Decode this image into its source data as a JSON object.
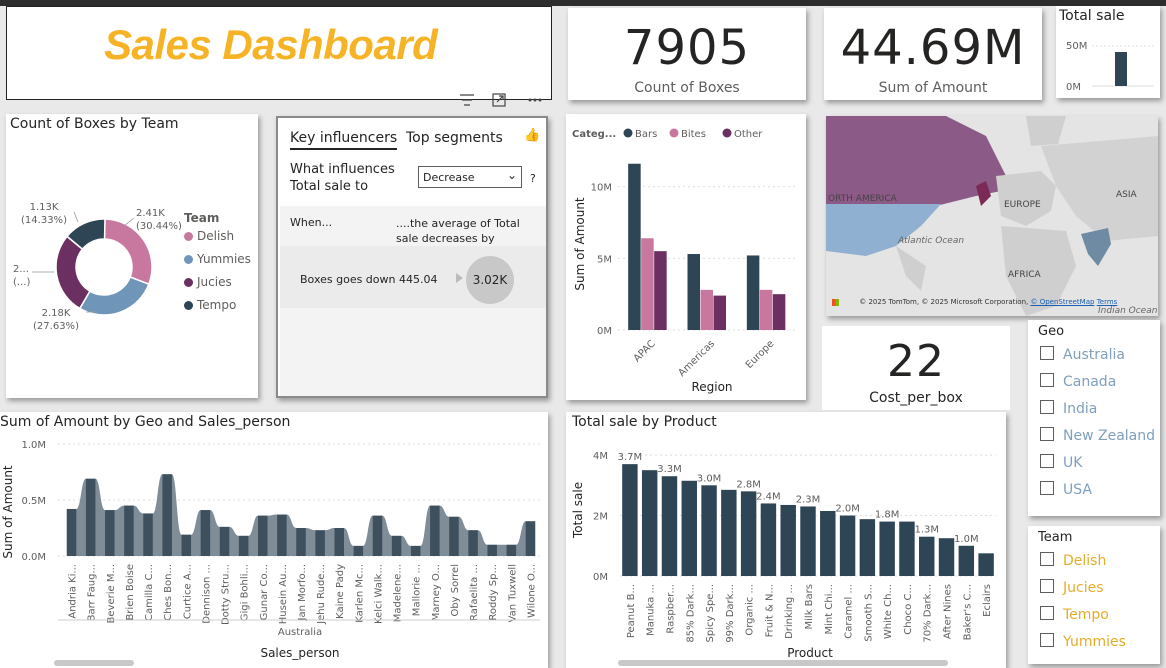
{
  "header": {
    "title": "Sales Dashboard"
  },
  "kpis": {
    "boxes": {
      "value": "7905",
      "label": "Count of Boxes"
    },
    "amount": {
      "value": "44.69M",
      "label": "Sum of Amount"
    },
    "cost": {
      "value": "22",
      "label": "Cost_per_box"
    }
  },
  "visual_header_icons": [
    "filter-icon",
    "focus-mode-icon",
    "more-options-icon"
  ],
  "total_sale_mini": {
    "title": "Total sale",
    "ticks": [
      "50M",
      "0M"
    ],
    "value_fraction": 0.85
  },
  "donut": {
    "title": "Count of Boxes by Team",
    "legend_title": "Team",
    "labels": [
      {
        "text_line1": "2.41K",
        "text_line2": "(30.44%)"
      },
      {
        "text_line1": "2.18K",
        "text_line2": "(27.63%)"
      },
      {
        "text_line1": "2...",
        "text_line2": "(...)"
      },
      {
        "text_line1": "1.13K",
        "text_line2": "(14.33%)"
      }
    ],
    "teams": [
      {
        "name": "Delish",
        "color": "#c8789f"
      },
      {
        "name": "Yummies",
        "color": "#6f96b8"
      },
      {
        "name": "Jucies",
        "color": "#6b2f62"
      },
      {
        "name": "Tempo",
        "color": "#2e4556"
      }
    ]
  },
  "key_influencers": {
    "tabs": [
      "Key influencers",
      "Top segments"
    ],
    "question_line1": "What influences",
    "question_line2": "Total sale to",
    "dropdown_value": "Decrease",
    "help": "?",
    "col_when": "When...",
    "col_avg": "....the average of Total sale decreases by",
    "row_label": "Boxes goes down 445.04",
    "row_value": "3.02K"
  },
  "region_chart": {
    "legend_title": "Categ...",
    "legend": [
      "Bars",
      "Bites",
      "Other"
    ],
    "colors": [
      "#2e4556",
      "#c8789f",
      "#6b2f62"
    ],
    "ytitle": "Sum of Amount",
    "xtitle": "Region",
    "yticks": [
      "10M",
      "5M",
      "0M"
    ],
    "categories": [
      "APAC",
      "Americas",
      "Europe"
    ]
  },
  "map": {
    "labels": [
      "ORTH AMERICA",
      "EUROPE",
      "ASIA",
      "Atlantic Ocean",
      "AFRICA",
      "Indian Ocean"
    ],
    "attribution": "© 2025 TomTom, © 2025 Microsoft Corporation, ",
    "osm": "© OpenStreetMap",
    "terms": "Terms"
  },
  "geo_slicer": {
    "title": "Geo",
    "items": [
      "Australia",
      "Canada",
      "India",
      "New Zealand",
      "UK",
      "USA"
    ]
  },
  "team_slicer": {
    "title": "Team",
    "items": [
      "Delish",
      "Jucies",
      "Tempo",
      "Yummies"
    ]
  },
  "geo_chart": {
    "title": "Sum of Amount by Geo and Sales_person",
    "ytitle": "Sum of Amount",
    "xtitle": "Sales_person",
    "group_label": "Australia",
    "yticks": [
      "1.0M",
      "0.5M",
      "0.0M"
    ],
    "people": [
      "Andria Ki...",
      "Barr Faug...",
      "Beverie M...",
      "Brien Boise",
      "Camilla C...",
      "Ches Bon...",
      "Curtice A...",
      "Dennison ...",
      "Dotty Stru...",
      "Gigi Bohli...",
      "Gunar Co...",
      "Husein Au...",
      "Jan Morfo...",
      "Jehu Rude...",
      "Kaine Pady",
      "Karlen Mc...",
      "Kelci Walk...",
      "Madelene...",
      "Mallorie ...",
      "Marney O...",
      "Oby Sorrel",
      "Rafaelita ...",
      "Roddy Sp...",
      "Van Tuxwell",
      "Wilone O..."
    ]
  },
  "product_chart": {
    "title": "Total sale by Product",
    "ytitle": "Total sale",
    "xtitle": "Product",
    "yticks": [
      "4M",
      "2M",
      "0M"
    ],
    "products": [
      "Peanut B...",
      "Manuka ...",
      "Raspber...",
      "85% Dark...",
      "Spicy Spe...",
      "99% Dark...",
      "Organic ...",
      "Fruit & N...",
      "Drinking ...",
      "Milk Bars",
      "Mint Chi...",
      "Caramel ...",
      "Smooth S...",
      "White Ch...",
      "Choco C...",
      "70% Dark...",
      "After Nines",
      "Baker's C...",
      "Eclairs"
    ],
    "data_labels": [
      "3.7M",
      "3.3M",
      "3.0M",
      "2.8M",
      "2.4M",
      "2.3M",
      "2.0M",
      "1.8M",
      "1.3M",
      "1.0M"
    ]
  },
  "chart_data": [
    {
      "type": "bar",
      "title": "Total sale by Product",
      "xlabel": "Product",
      "ylabel": "Total sale",
      "ylim": [
        0,
        4.3
      ],
      "unit": "M",
      "categories": [
        "Peanut B...",
        "Manuka ...",
        "Raspber...",
        "85% Dark...",
        "Spicy Spe...",
        "99% Dark...",
        "Organic ...",
        "Fruit & N...",
        "Drinking ...",
        "Milk Bars",
        "Mint Chi...",
        "Caramel ...",
        "Smooth S...",
        "White Ch...",
        "Choco C...",
        "70% Dark...",
        "After Nines",
        "Baker's C...",
        "Eclairs"
      ],
      "values": [
        3.7,
        3.5,
        3.3,
        3.15,
        3.0,
        2.85,
        2.8,
        2.4,
        2.35,
        2.3,
        2.15,
        2.0,
        1.88,
        1.8,
        1.8,
        1.3,
        1.25,
        1.0,
        0.75
      ],
      "label_indices": [
        0,
        2,
        4,
        6,
        7,
        9,
        11,
        13,
        15,
        17
      ]
    },
    {
      "type": "bar",
      "title": "",
      "xlabel": "Region",
      "ylabel": "Sum of Amount",
      "ylim": [
        0,
        12
      ],
      "unit": "M",
      "categories": [
        "APAC",
        "Americas",
        "Europe"
      ],
      "series": [
        {
          "name": "Bars",
          "values": [
            11.6,
            5.3,
            5.2
          ]
        },
        {
          "name": "Bites",
          "values": [
            6.4,
            2.8,
            2.8
          ]
        },
        {
          "name": "Other",
          "values": [
            5.5,
            2.4,
            2.5
          ]
        }
      ]
    },
    {
      "type": "area",
      "title": "Sum of Amount by Geo and Sales_person",
      "xlabel": "Sales_person",
      "ylabel": "Sum of Amount",
      "ylim": [
        0,
        1.0
      ],
      "unit": "M",
      "categories": [
        "Andria Ki...",
        "Barr Faug...",
        "Beverie M...",
        "Brien Boise",
        "Camilla C...",
        "Ches Bon...",
        "Curtice A...",
        "Dennison ...",
        "Dotty Stru...",
        "Gigi Bohli...",
        "Gunar Co...",
        "Husein Au...",
        "Jan Morfo...",
        "Jehu Rude...",
        "Kaine Pady",
        "Karlen Mc...",
        "Kelci Walk...",
        "Madelene...",
        "Mallorie ...",
        "Marney O...",
        "Oby Sorrel",
        "Rafaelita ...",
        "Roddy Sp...",
        "Van Tuxwell",
        "Wilone O..."
      ],
      "values": [
        0.42,
        0.69,
        0.41,
        0.45,
        0.38,
        0.73,
        0.19,
        0.41,
        0.26,
        0.18,
        0.36,
        0.37,
        0.25,
        0.23,
        0.25,
        0.09,
        0.36,
        0.18,
        0.09,
        0.45,
        0.35,
        0.23,
        0.1,
        0.1,
        0.31
      ]
    },
    {
      "type": "pie",
      "title": "Count of Boxes by Team",
      "categories": [
        "Delish",
        "Yummies",
        "Jucies",
        "Tempo"
      ],
      "values": [
        2.41,
        2.18,
        2.18,
        1.13
      ],
      "percent": [
        30.44,
        27.63,
        27.6,
        14.33
      ]
    }
  ]
}
